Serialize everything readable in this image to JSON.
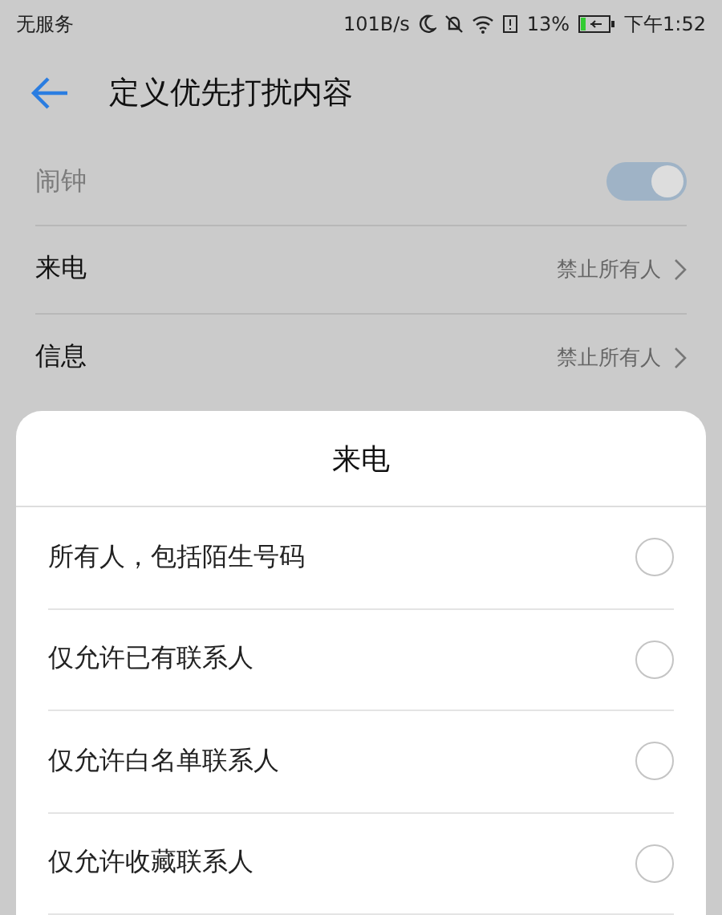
{
  "status_bar": {
    "carrier": "无服务",
    "speed": "101B/s",
    "battery_percent": "13%",
    "time": "下午1:52"
  },
  "header": {
    "title": "定义优先打扰内容"
  },
  "settings": [
    {
      "kind": "toggle",
      "label": "闹钟",
      "disabled": true,
      "on": true
    },
    {
      "kind": "link",
      "label": "来电",
      "value": "禁止所有人"
    },
    {
      "kind": "link",
      "label": "信息",
      "value": "禁止所有人"
    }
  ],
  "sheet": {
    "title": "来电",
    "options": [
      {
        "label": "所有人，包括陌生号码",
        "selected": false
      },
      {
        "label": "仅允许已有联系人",
        "selected": false
      },
      {
        "label": "仅允许白名单联系人",
        "selected": false
      },
      {
        "label": "仅允许收藏联系人",
        "selected": false
      }
    ]
  }
}
